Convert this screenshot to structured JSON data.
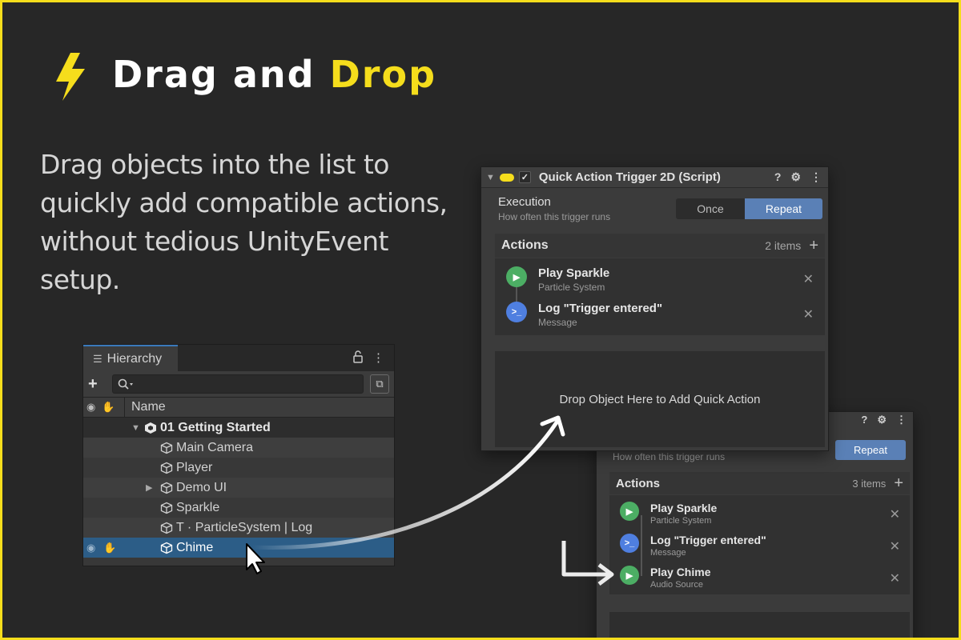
{
  "heading": {
    "word1": "Drag and",
    "word2": "Drop",
    "icon": "lightning-bolt-icon",
    "accent_color": "#f5dd1c"
  },
  "subtitle": {
    "line1": "Drag objects into the list to",
    "line2": "quickly add compatible actions,",
    "line3": "without tedious UnityEvent",
    "line4": "setup."
  },
  "hierarchy": {
    "tab_label": "Hierarchy",
    "column_name": "Name",
    "search_placeholder": "",
    "rows": [
      {
        "label": "01 Getting Started",
        "kind": "scene"
      },
      {
        "label": "Main Camera"
      },
      {
        "label": "Player"
      },
      {
        "label": "Demo UI",
        "expandable": true
      },
      {
        "label": "Sparkle"
      },
      {
        "label": "T · ParticleSystem | Log"
      },
      {
        "label": "Chime",
        "selected": true
      }
    ]
  },
  "inspector_main": {
    "title": "Quick Action Trigger 2D (Script)",
    "execution_label": "Execution",
    "execution_help": "How often this trigger runs",
    "option_once": "Once",
    "option_repeat": "Repeat",
    "selected_option": "Repeat",
    "actions_label": "Actions",
    "count": "2 items",
    "actions": [
      {
        "name": "Play Sparkle",
        "sub": "Particle System",
        "icon": "play-icon",
        "color": "#4cae64"
      },
      {
        "name": "Log \"Trigger entered\"",
        "sub": "Message",
        "icon": "terminal-icon",
        "color": "#4f7fe0"
      }
    ],
    "dropzone_text": "Drop Object Here to Add Quick Action"
  },
  "inspector_result": {
    "execution_help": "How often this trigger runs",
    "option_repeat": "Repeat",
    "actions_label": "Actions",
    "count": "3 items",
    "actions": [
      {
        "name": "Play Sparkle",
        "sub": "Particle System",
        "icon": "play-icon",
        "color": "#4cae64"
      },
      {
        "name": "Log \"Trigger entered\"",
        "sub": "Message",
        "icon": "terminal-icon",
        "color": "#4f7fe0"
      },
      {
        "name": "Play Chime",
        "sub": "Audio Source",
        "icon": "play-icon",
        "color": "#4cae64"
      }
    ]
  }
}
